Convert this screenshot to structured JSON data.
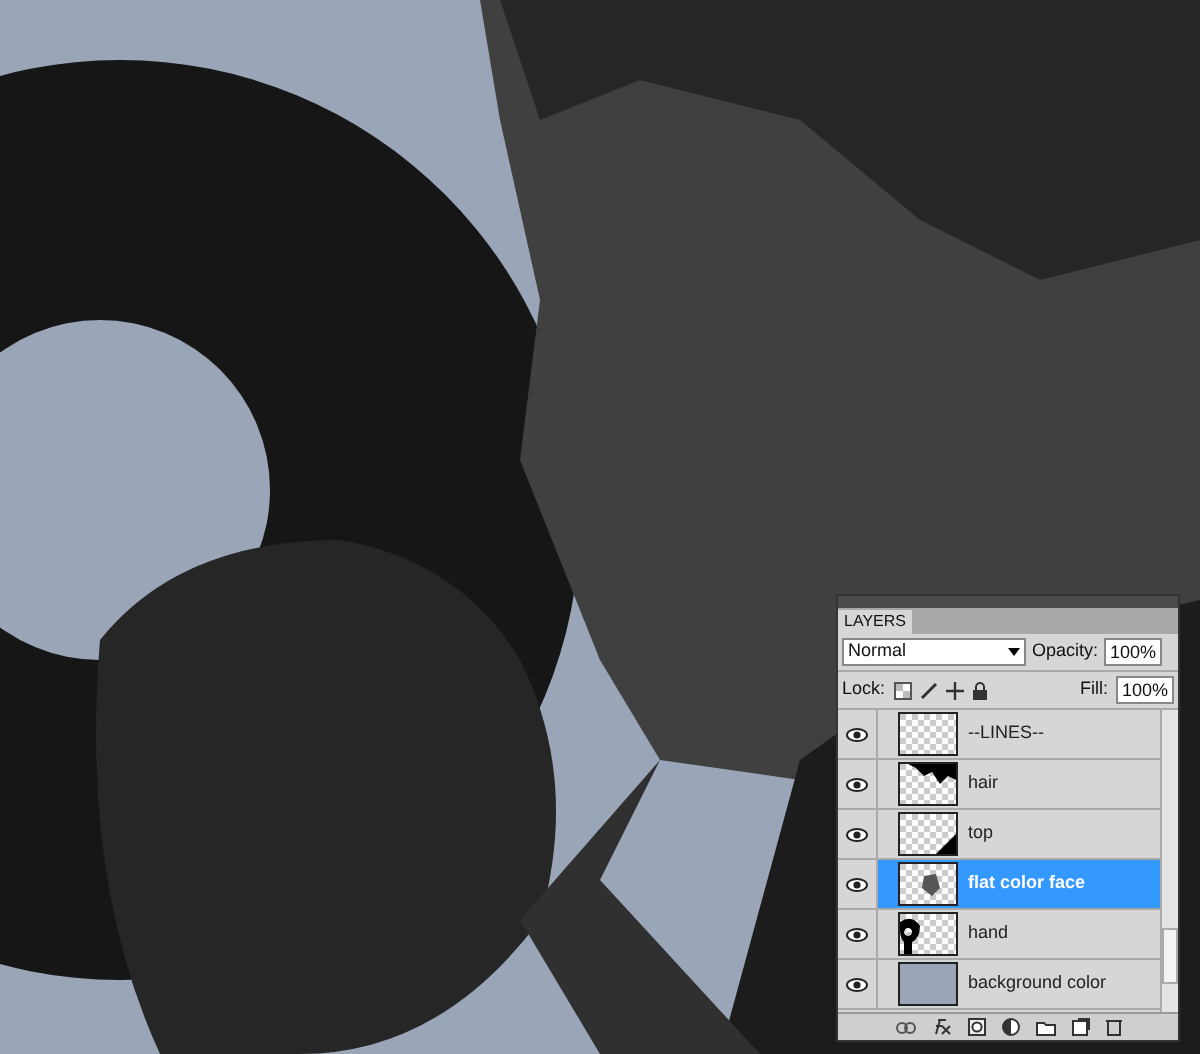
{
  "layers_panel": {
    "tab": "LAYERS",
    "blend_mode": "Normal",
    "opacity_label": "Opacity:",
    "opacity": "100%",
    "lock_label": "Lock:",
    "fill_label": "Fill:",
    "fill": "100%",
    "layers": [
      {
        "name": "--LINES--",
        "visible": true,
        "selected": false,
        "kind": "empty"
      },
      {
        "name": "hair",
        "visible": true,
        "selected": false,
        "kind": "hair"
      },
      {
        "name": "top",
        "visible": true,
        "selected": false,
        "kind": "top"
      },
      {
        "name": "flat color face",
        "visible": true,
        "selected": true,
        "kind": "face"
      },
      {
        "name": "hand",
        "visible": true,
        "selected": false,
        "kind": "hand"
      },
      {
        "name": "background color",
        "visible": true,
        "selected": false,
        "kind": "fill"
      }
    ]
  }
}
